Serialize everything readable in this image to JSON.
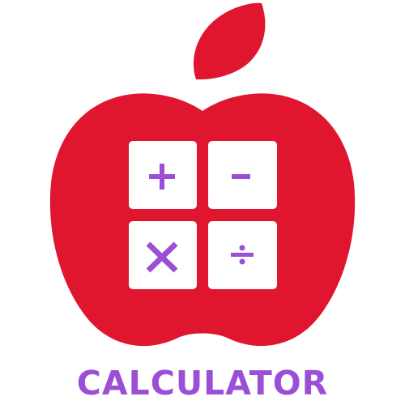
{
  "logo": {
    "wordmark": "CALCULATOR",
    "apple_color": "#e0162f",
    "accent_color": "#9b4fd6",
    "keys": [
      {
        "symbol": "+",
        "icon": "plus-icon"
      },
      {
        "symbol": "−",
        "icon": "minus-icon"
      },
      {
        "symbol": "×",
        "icon": "multiply-icon"
      },
      {
        "symbol": "÷",
        "icon": "divide-icon"
      }
    ]
  }
}
